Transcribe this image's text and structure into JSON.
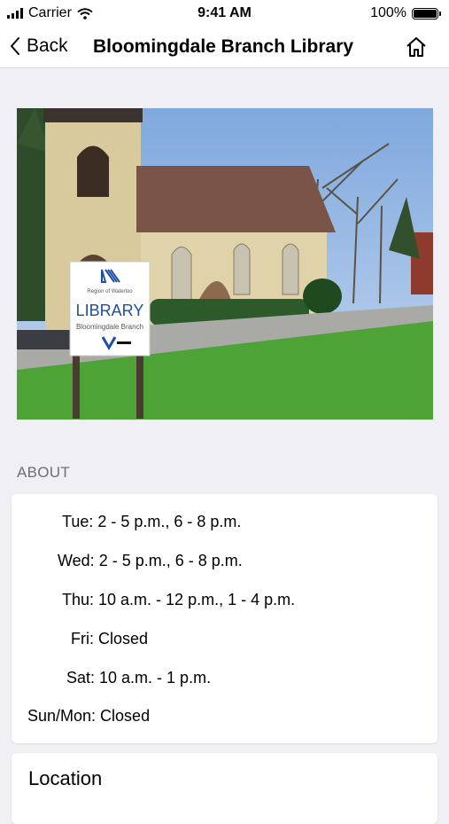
{
  "status_bar": {
    "carrier": "Carrier",
    "time": "9:41 AM",
    "battery_pct": "100%"
  },
  "nav": {
    "back_label": "Back",
    "title": "Bloomingdale Branch Library"
  },
  "photo_sign": {
    "region": "Region of Waterloo",
    "library": "LIBRARY",
    "branch": "Bloomingdale Branch"
  },
  "about": {
    "heading": "ABOUT",
    "hours": [
      "Tue: 2 - 5 p.m., 6 - 8 p.m.",
      "Wed: 2 - 5 p.m., 6 - 8 p.m.",
      "Thu: 10 a.m. - 12 p.m., 1 - 4 p.m.",
      "Fri: Closed",
      "Sat: 10 a.m. - 1 p.m.",
      "Sun/Mon: Closed"
    ]
  },
  "location": {
    "heading": "Location"
  },
  "icons": {
    "back": "chevron-left-icon",
    "home": "home-icon",
    "wifi": "wifi-icon",
    "battery": "battery-icon",
    "signal": "signal-icon"
  }
}
